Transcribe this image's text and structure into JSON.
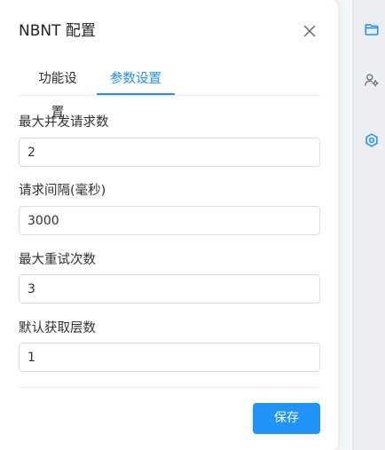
{
  "dialog": {
    "title": "NBNT 配置"
  },
  "tabs": [
    {
      "label": "功能设置",
      "active": false
    },
    {
      "label": "参数设置",
      "active": true
    }
  ],
  "fields": [
    {
      "label": "最大并发请求数",
      "value": "2"
    },
    {
      "label": "请求间隔(毫秒)",
      "value": "3000"
    },
    {
      "label": "最大重试次数",
      "value": "3"
    },
    {
      "label": "默认获取层数",
      "value": "1"
    }
  ],
  "actions": {
    "save_label": "保存"
  },
  "rail": {
    "icons": [
      "folder-icon",
      "user-settings-icon",
      "gear-circle-icon"
    ]
  },
  "colors": {
    "accent": "#1f8ff5",
    "button": "#1f93f8"
  }
}
